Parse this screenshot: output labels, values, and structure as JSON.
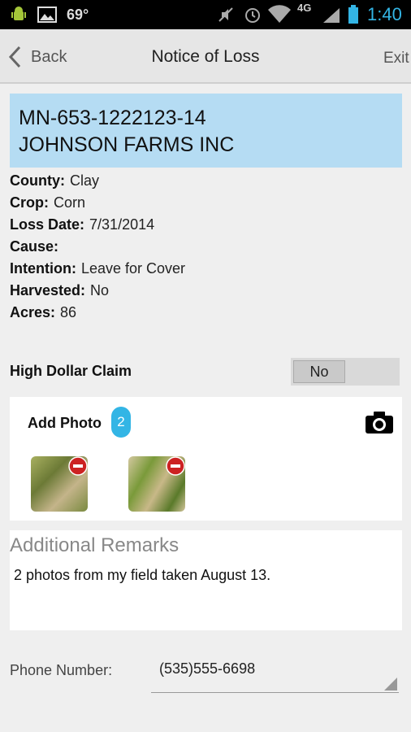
{
  "status_bar": {
    "temperature": "69°",
    "network": "4G",
    "time": "1:40"
  },
  "action_bar": {
    "back_label": "Back",
    "title": "Notice of Loss",
    "exit_label": "Exit"
  },
  "policy": {
    "number": "MN-653-1222123-14",
    "name": "JOHNSON FARMS INC"
  },
  "details": [
    {
      "key": "County:",
      "value": "Clay"
    },
    {
      "key": "Crop:",
      "value": "Corn"
    },
    {
      "key": "Loss Date:",
      "value": "7/31/2014"
    },
    {
      "key": "Cause:",
      "value": ""
    },
    {
      "key": "Intention:",
      "value": "Leave for Cover"
    },
    {
      "key": "Harvested:",
      "value": "No"
    },
    {
      "key": "Acres:",
      "value": "86"
    }
  ],
  "high_dollar_claim": {
    "label": "High Dollar Claim",
    "value": "No"
  },
  "photos": {
    "label": "Add Photo",
    "count": "2"
  },
  "remarks": {
    "heading": "Additional Remarks",
    "text": "2 photos from my field taken August 13."
  },
  "phone": {
    "label": "Phone Number:",
    "value": "(535)555-6698"
  },
  "colors": {
    "accent": "#33b5e5",
    "policy_bg": "#b5dcf3",
    "remove": "#cc2222"
  }
}
